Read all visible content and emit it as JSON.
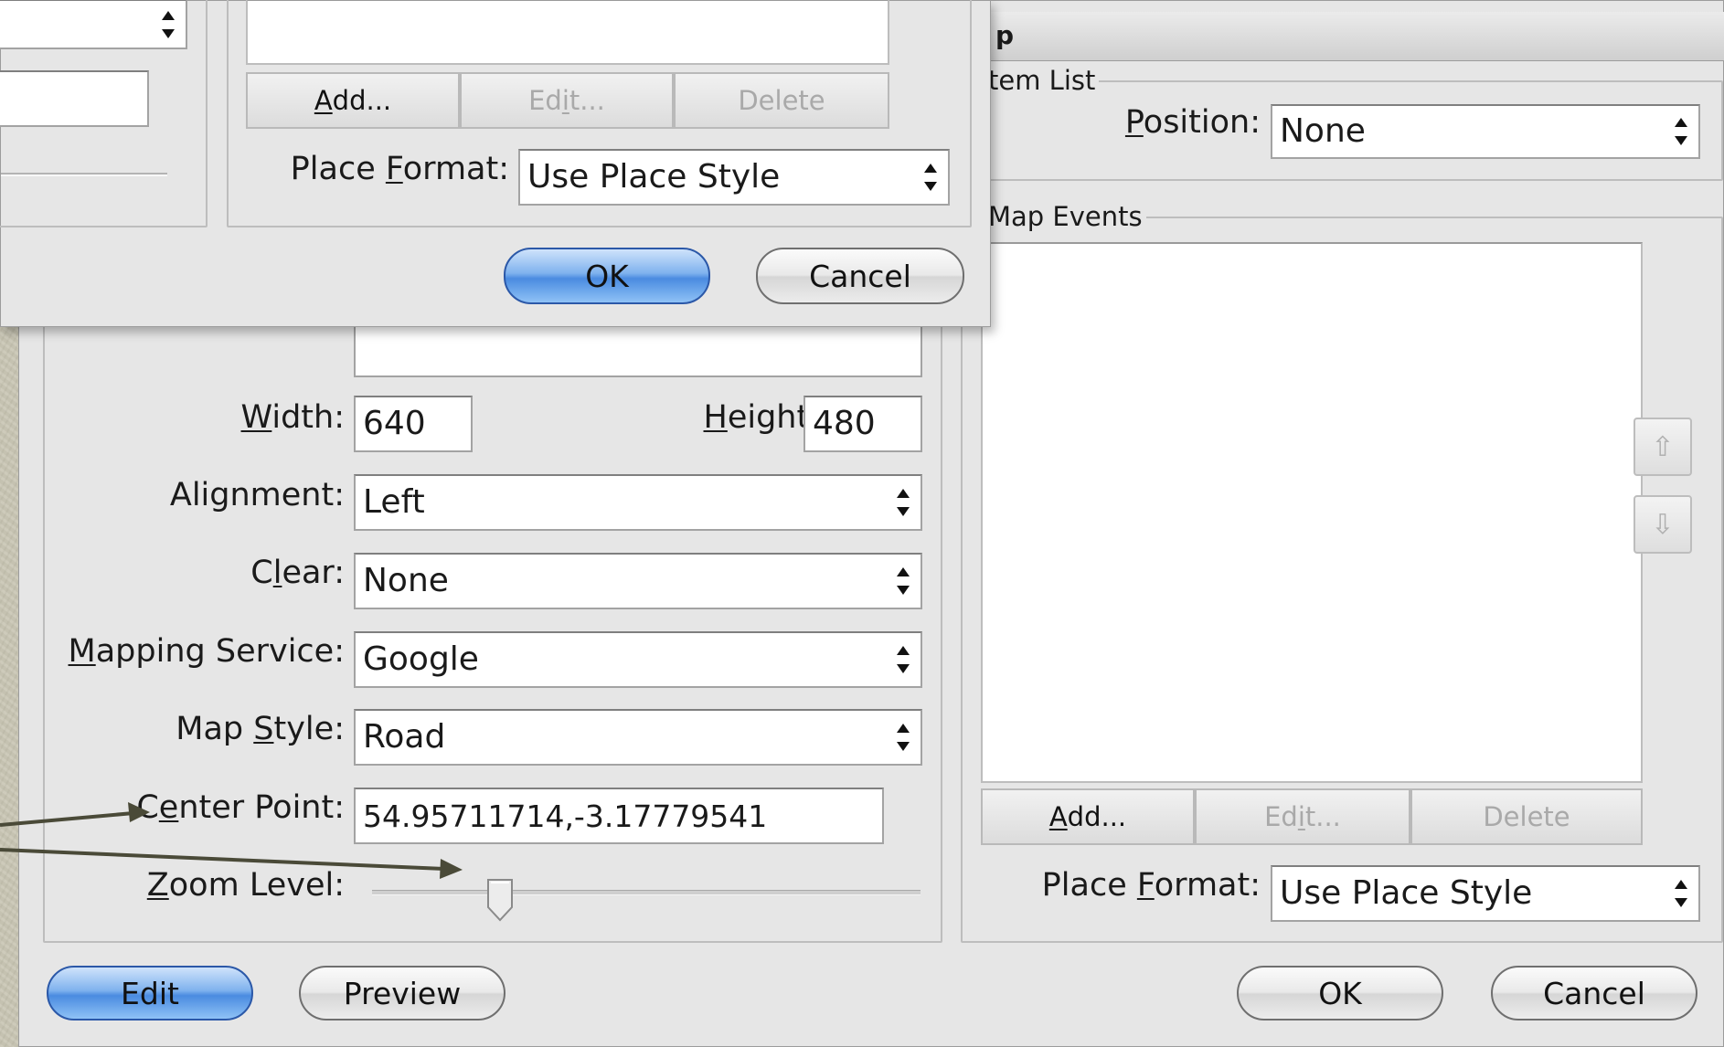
{
  "main_dialog": {
    "title_fragment": "p",
    "item_list": {
      "title": "tem List",
      "position_label_before": "",
      "position_label_mnemonic": "P",
      "position_label_after": "osition:",
      "position_value": "None"
    },
    "map_events": {
      "title": "Map Events",
      "add_label_mnemonic": "A",
      "add_label_after": "dd...",
      "edit_label_before": "Ed",
      "edit_label_mnemonic": "i",
      "edit_label_after": "t...",
      "delete_label": "Delete",
      "place_format_label_before": "Place ",
      "place_format_label_mnemonic": "F",
      "place_format_label_after": "ormat:",
      "place_format_value": "Use Place Style",
      "move_up_icon": "⇧",
      "move_down_icon": "⇩"
    },
    "map_settings": {
      "width_label_mnemonic": "W",
      "width_label_after": "idth:",
      "width_value": "640",
      "height_label_mnemonic": "H",
      "height_label_after": "eight:",
      "height_value": "480",
      "alignment_label": "Alignment:",
      "alignment_value": "Left",
      "clear_label_before": "C",
      "clear_label_mnemonic": "l",
      "clear_label_after": "ear:",
      "clear_value": "None",
      "mapping_service_label_mnemonic": "M",
      "mapping_service_label_after": "apping Service:",
      "mapping_service_value": "Google",
      "map_style_label_before": "Map ",
      "map_style_label_mnemonic": "S",
      "map_style_label_after": "tyle:",
      "map_style_value": "Road",
      "center_point_label_before": "C",
      "center_point_label_mnemonic": "e",
      "center_point_label_after": "nter Point:",
      "center_point_value": "54.95711714,-3.17779541",
      "zoom_label_mnemonic": "Z",
      "zoom_label_after": "oom Level:",
      "zoom_level_fraction": 0.22
    },
    "footer": {
      "edit_label": "Edit",
      "preview_label": "Preview",
      "ok_label": "OK",
      "cancel_label": "Cancel"
    }
  },
  "overlay_dialog": {
    "add_label_mnemonic": "A",
    "add_label_after": "dd...",
    "edit_label_before": "Ed",
    "edit_label_mnemonic": "i",
    "edit_label_after": "t...",
    "delete_label": "Delete",
    "place_format_label_before": "Place ",
    "place_format_label_mnemonic": "F",
    "place_format_label_after": "ormat:",
    "place_format_value": "Use Place Style",
    "ok_label": "OK",
    "cancel_label": "Cancel"
  },
  "colors": {
    "dialog_bg": "#e6e6e6",
    "default_button_blue": "#4a8be0",
    "annotation_arrow": "#4a4a38",
    "desktop": "#c9c6b4"
  }
}
